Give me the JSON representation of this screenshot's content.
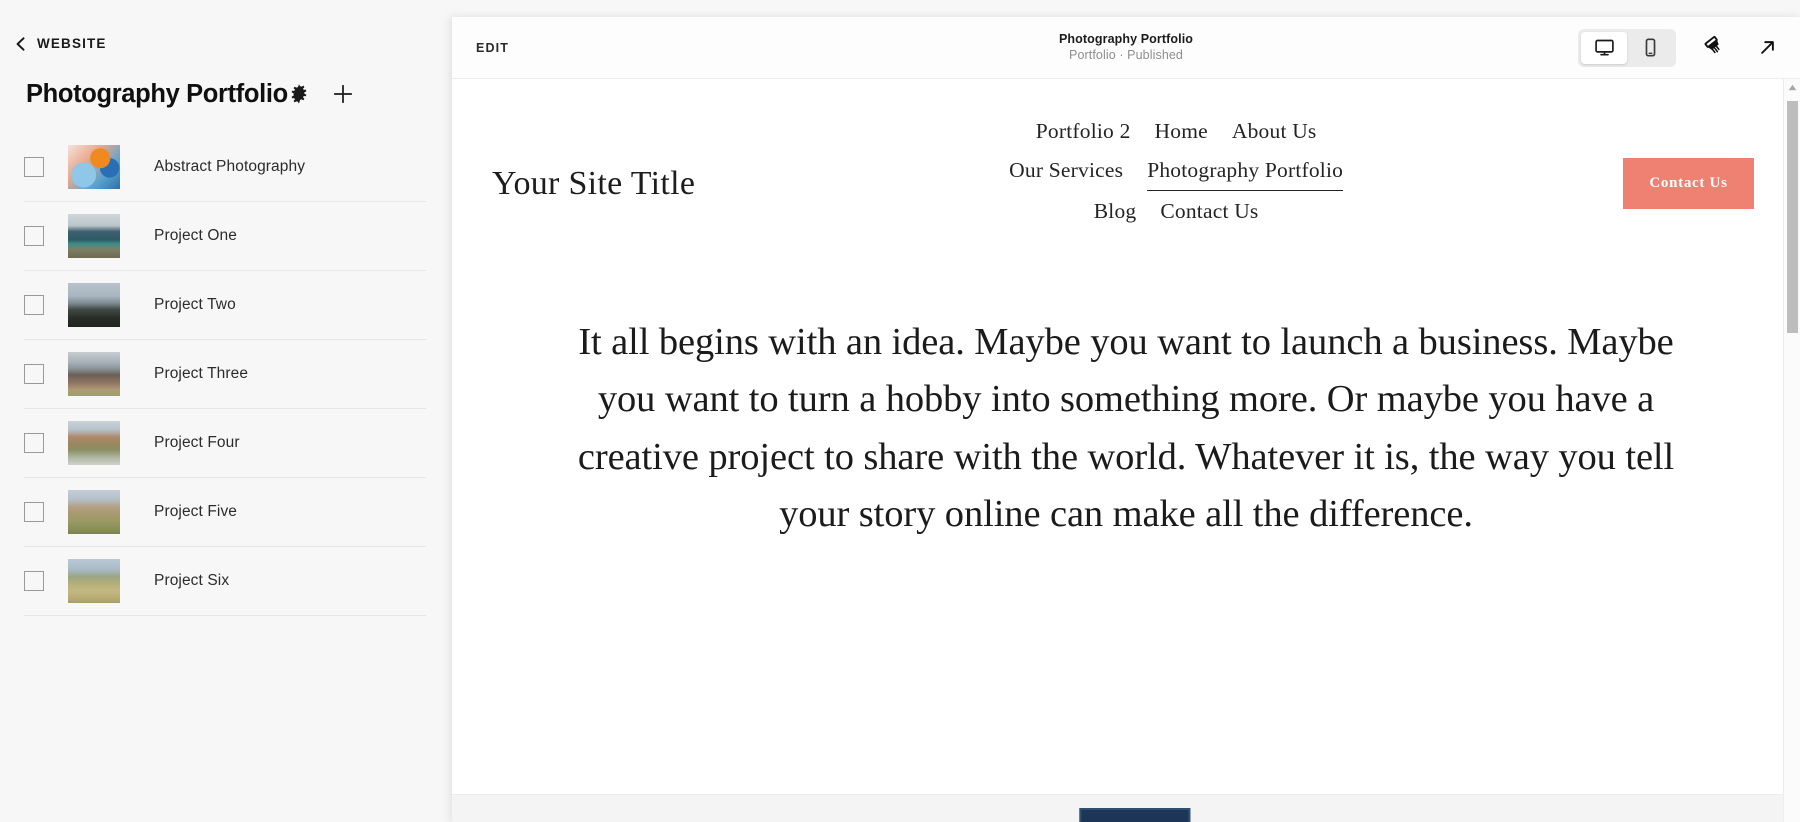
{
  "sidebar": {
    "back": {
      "label": "WEBSITE",
      "icon": "chevron-left-icon"
    },
    "panel_title": "Photography Portfolio",
    "header_actions": [
      {
        "name": "settings",
        "icon": "gear-icon"
      },
      {
        "name": "add",
        "icon": "plus-icon"
      }
    ],
    "items": [
      {
        "label": "Abstract Photography",
        "thumb": "th-abstract",
        "checked": false
      },
      {
        "label": "Project One",
        "thumb": "th-one",
        "checked": false
      },
      {
        "label": "Project Two",
        "thumb": "th-two",
        "checked": false
      },
      {
        "label": "Project Three",
        "thumb": "th-three",
        "checked": false
      },
      {
        "label": "Project Four",
        "thumb": "th-four",
        "checked": false
      },
      {
        "label": "Project Five",
        "thumb": "th-five",
        "checked": false
      },
      {
        "label": "Project Six",
        "thumb": "th-six",
        "checked": false
      }
    ]
  },
  "toolbar": {
    "edit_label": "EDIT",
    "title": "Photography Portfolio",
    "subtitle": "Portfolio · Published",
    "devices": [
      {
        "name": "desktop",
        "icon": "monitor-icon",
        "active": true
      },
      {
        "name": "mobile",
        "icon": "phone-icon",
        "active": false
      }
    ],
    "actions": [
      {
        "name": "style",
        "icon": "paintbrush-icon"
      },
      {
        "name": "open-external",
        "icon": "arrow-up-right-icon"
      }
    ]
  },
  "site": {
    "title": "Your Site Title",
    "nav_rows": [
      [
        {
          "label": "Portfolio 2",
          "active": false
        },
        {
          "label": "Home",
          "active": false
        },
        {
          "label": "About Us",
          "active": false
        }
      ],
      [
        {
          "label": "Our Services",
          "active": false
        },
        {
          "label": "Photography Portfolio",
          "active": true
        }
      ],
      [
        {
          "label": "Blog",
          "active": false
        },
        {
          "label": "Contact Us",
          "active": false
        }
      ]
    ],
    "cta_label": "Contact Us",
    "cta_color": "#ef8173",
    "body_text": "It all begins with an idea. Maybe you want to launch a business. Maybe you want to turn a hobby into something more. Or maybe you have a creative project to share with the world. Whatever it is, the way you tell your story online can make all the difference."
  }
}
